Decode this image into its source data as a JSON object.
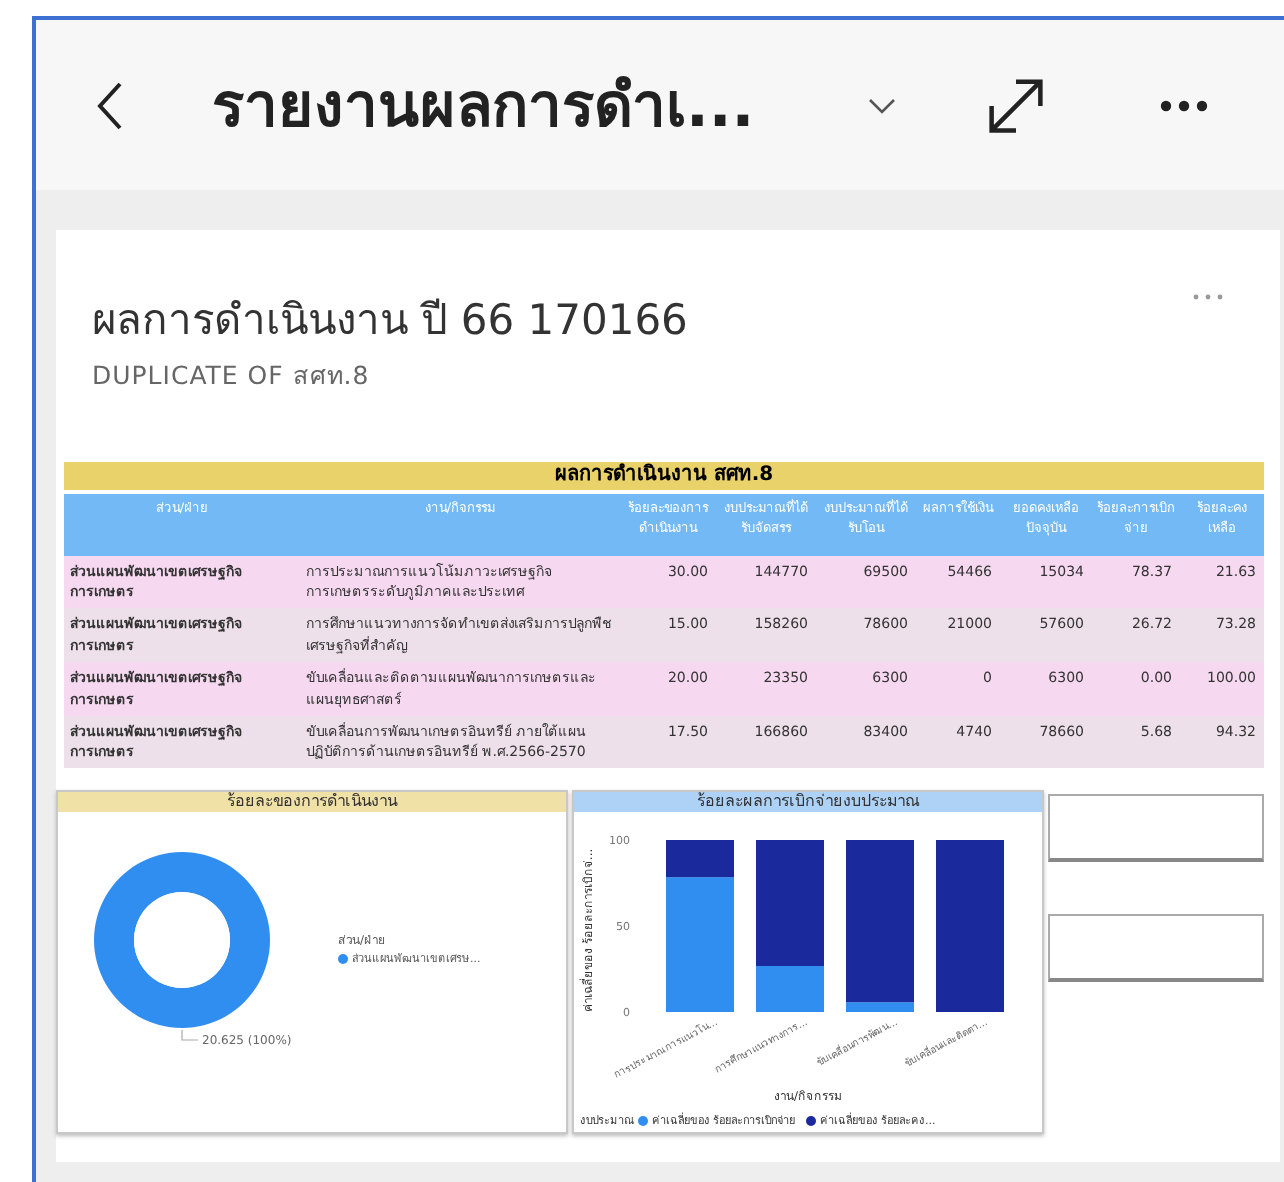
{
  "header": {
    "title": "รายงานผลการดำเ..."
  },
  "card": {
    "title": "ผลการดำเนินงาน ปี 66 170166",
    "subtitle": "DUPLICATE OF สศท.8"
  },
  "table": {
    "title": "ผลการดำเนินงาน สศท.8",
    "columns": [
      "ส่วน/ฝ่าย",
      "งาน/กิจกรรม",
      "ร้อยละของการดำเนินงาน",
      "งบประมาณที่ได้รับจัดสรร",
      "งบประมาณที่ได้รับโอน",
      "ผลการใช้เงิน",
      "ยอดคงเหลือปัจจุบัน",
      "ร้อยละการเบิกจ่าย",
      "ร้อยละคงเหลือ"
    ],
    "rows": [
      [
        "ส่วนแผนพัฒนาเขตเศรษฐกิจการเกษตร",
        "การประมาณการแนวโน้มภาวะเศรษฐกิจการเกษตรระดับภูมิภาคและประเทศ",
        "30.00",
        "144770",
        "69500",
        "54466",
        "15034",
        "78.37",
        "21.63"
      ],
      [
        "ส่วนแผนพัฒนาเขตเศรษฐกิจการเกษตร",
        "การศึกษาแนวทางการจัดทำเขตส่งเสริมการปลูกพืชเศรษฐกิจที่สำคัญ",
        "15.00",
        "158260",
        "78600",
        "21000",
        "57600",
        "26.72",
        "73.28"
      ],
      [
        "ส่วนแผนพัฒนาเขตเศรษฐกิจการเกษตร",
        "ขับเคลื่อนและติดตามแผนพัฒนาการเกษตรและแผนยุทธศาสตร์",
        "20.00",
        "23350",
        "6300",
        "0",
        "6300",
        "0.00",
        "100.00"
      ],
      [
        "ส่วนแผนพัฒนาเขตเศรษฐกิจการเกษตร",
        "ขับเคลื่อนการพัฒนาเกษตรอินทรีย์ ภายใต้แผนปฏิบัติการด้านเกษตรอินทรีย์ พ.ศ.2566-2570",
        "17.50",
        "166860",
        "83400",
        "4740",
        "78660",
        "5.68",
        "94.32"
      ]
    ]
  },
  "donut": {
    "chart_data": {
      "type": "donut",
      "title": "ร้อยละของการดำเนินงาน",
      "legend": {
        "title": "ส่วน/ฝ่าย"
      },
      "value_labels": [
        "20.625 (100%)"
      ],
      "categories": [
        "ส่วนแผนพัฒนาเขตเศรษ..."
      ],
      "values": [
        100
      ]
    }
  },
  "bars": {
    "chart_data": {
      "type": "bar",
      "stacked": true,
      "title": "ร้อยละผลการเบิกจ่ายงบประมาณ",
      "xlabel": "งาน/กิจกรรม",
      "ylabel": "ค่าเฉลี่ยของ ร้อยละการเบิกจ่...",
      "legend": {
        "title": "งบประมาณ"
      },
      "categories": [
        "การประมาณการแนวโน...",
        "การศึกษาแนวทางการ...",
        "ขับเคลื่อนการพัฒน...",
        "ขับเคลื่อนและติดตา..."
      ],
      "ylim": [
        0,
        100
      ],
      "yticks": [
        0,
        50,
        100
      ],
      "series": [
        {
          "name": "ค่าเฉลี่ยของ ร้อยละการเบิกจ่าย",
          "color": "#2f8ef0",
          "values": [
            78.37,
            26.72,
            5.68,
            0
          ]
        },
        {
          "name": "ค่าเฉลี่ยของ ร้อยละคง...",
          "color": "#1a2a9c",
          "values": [
            21.63,
            73.28,
            94.32,
            100
          ]
        }
      ]
    }
  }
}
